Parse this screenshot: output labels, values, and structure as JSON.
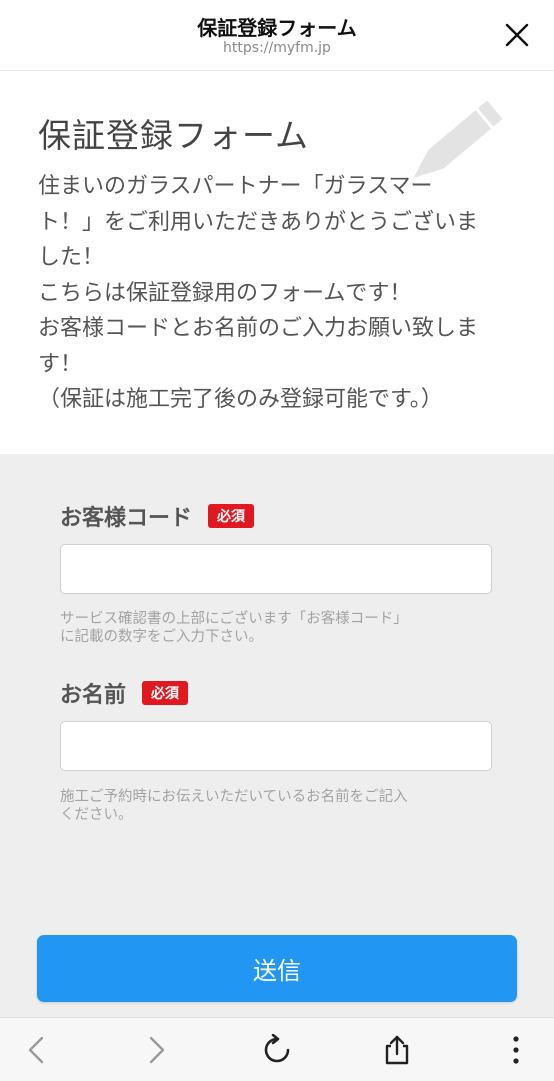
{
  "header": {
    "title": "保証登録フォーム",
    "url": "https://myfm.jp"
  },
  "intro": {
    "heading": "保証登録フォーム",
    "lines": [
      "住まいのガラスパートナー「ガラスマー",
      "ト！」をご利用いただきありがとうございま",
      "した！",
      "こちらは保証登録用のフォームです！",
      "お客様コードとお名前のご入力お願い致しま",
      "す！",
      "（保証は施工完了後のみ登録可能です。）"
    ]
  },
  "form": {
    "customer_code": {
      "label": "お客様コード",
      "required": "必須",
      "value": "",
      "help": [
        "サービス確認書の上部にございます「お客様コード」",
        "に記載の数字をご入力下さい。"
      ]
    },
    "name": {
      "label": "お名前",
      "required": "必須",
      "value": "",
      "help": [
        "施工ご予約時にお伝えいただいているお名前をご記入",
        "ください。"
      ]
    },
    "submit_label": "送信"
  },
  "colors": {
    "accent": "#2196f3",
    "required_badge": "#e0181f",
    "form_background": "#eeeeee"
  },
  "icons": {
    "close": "close-icon",
    "decoration": "pencil-icon",
    "back": "chevron-left-icon",
    "forward": "chevron-right-icon",
    "reload": "reload-icon",
    "share": "share-icon",
    "menu": "more-vertical-icon"
  }
}
